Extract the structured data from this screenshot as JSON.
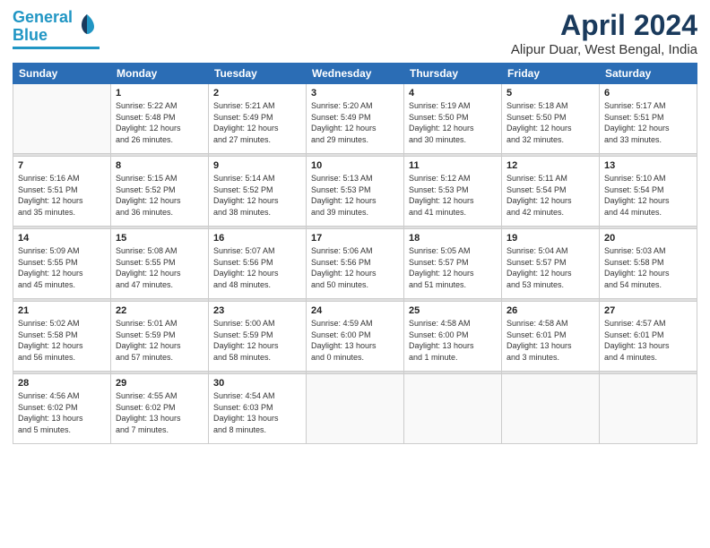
{
  "logo": {
    "line1": "General",
    "line2": "Blue"
  },
  "title": "April 2024",
  "subtitle": "Alipur Duar, West Bengal, India",
  "weekdays": [
    "Sunday",
    "Monday",
    "Tuesday",
    "Wednesday",
    "Thursday",
    "Friday",
    "Saturday"
  ],
  "weeks": [
    [
      {
        "day": "",
        "info": ""
      },
      {
        "day": "1",
        "info": "Sunrise: 5:22 AM\nSunset: 5:48 PM\nDaylight: 12 hours\nand 26 minutes."
      },
      {
        "day": "2",
        "info": "Sunrise: 5:21 AM\nSunset: 5:49 PM\nDaylight: 12 hours\nand 27 minutes."
      },
      {
        "day": "3",
        "info": "Sunrise: 5:20 AM\nSunset: 5:49 PM\nDaylight: 12 hours\nand 29 minutes."
      },
      {
        "day": "4",
        "info": "Sunrise: 5:19 AM\nSunset: 5:50 PM\nDaylight: 12 hours\nand 30 minutes."
      },
      {
        "day": "5",
        "info": "Sunrise: 5:18 AM\nSunset: 5:50 PM\nDaylight: 12 hours\nand 32 minutes."
      },
      {
        "day": "6",
        "info": "Sunrise: 5:17 AM\nSunset: 5:51 PM\nDaylight: 12 hours\nand 33 minutes."
      }
    ],
    [
      {
        "day": "7",
        "info": "Sunrise: 5:16 AM\nSunset: 5:51 PM\nDaylight: 12 hours\nand 35 minutes."
      },
      {
        "day": "8",
        "info": "Sunrise: 5:15 AM\nSunset: 5:52 PM\nDaylight: 12 hours\nand 36 minutes."
      },
      {
        "day": "9",
        "info": "Sunrise: 5:14 AM\nSunset: 5:52 PM\nDaylight: 12 hours\nand 38 minutes."
      },
      {
        "day": "10",
        "info": "Sunrise: 5:13 AM\nSunset: 5:53 PM\nDaylight: 12 hours\nand 39 minutes."
      },
      {
        "day": "11",
        "info": "Sunrise: 5:12 AM\nSunset: 5:53 PM\nDaylight: 12 hours\nand 41 minutes."
      },
      {
        "day": "12",
        "info": "Sunrise: 5:11 AM\nSunset: 5:54 PM\nDaylight: 12 hours\nand 42 minutes."
      },
      {
        "day": "13",
        "info": "Sunrise: 5:10 AM\nSunset: 5:54 PM\nDaylight: 12 hours\nand 44 minutes."
      }
    ],
    [
      {
        "day": "14",
        "info": "Sunrise: 5:09 AM\nSunset: 5:55 PM\nDaylight: 12 hours\nand 45 minutes."
      },
      {
        "day": "15",
        "info": "Sunrise: 5:08 AM\nSunset: 5:55 PM\nDaylight: 12 hours\nand 47 minutes."
      },
      {
        "day": "16",
        "info": "Sunrise: 5:07 AM\nSunset: 5:56 PM\nDaylight: 12 hours\nand 48 minutes."
      },
      {
        "day": "17",
        "info": "Sunrise: 5:06 AM\nSunset: 5:56 PM\nDaylight: 12 hours\nand 50 minutes."
      },
      {
        "day": "18",
        "info": "Sunrise: 5:05 AM\nSunset: 5:57 PM\nDaylight: 12 hours\nand 51 minutes."
      },
      {
        "day": "19",
        "info": "Sunrise: 5:04 AM\nSunset: 5:57 PM\nDaylight: 12 hours\nand 53 minutes."
      },
      {
        "day": "20",
        "info": "Sunrise: 5:03 AM\nSunset: 5:58 PM\nDaylight: 12 hours\nand 54 minutes."
      }
    ],
    [
      {
        "day": "21",
        "info": "Sunrise: 5:02 AM\nSunset: 5:58 PM\nDaylight: 12 hours\nand 56 minutes."
      },
      {
        "day": "22",
        "info": "Sunrise: 5:01 AM\nSunset: 5:59 PM\nDaylight: 12 hours\nand 57 minutes."
      },
      {
        "day": "23",
        "info": "Sunrise: 5:00 AM\nSunset: 5:59 PM\nDaylight: 12 hours\nand 58 minutes."
      },
      {
        "day": "24",
        "info": "Sunrise: 4:59 AM\nSunset: 6:00 PM\nDaylight: 13 hours\nand 0 minutes."
      },
      {
        "day": "25",
        "info": "Sunrise: 4:58 AM\nSunset: 6:00 PM\nDaylight: 13 hours\nand 1 minute."
      },
      {
        "day": "26",
        "info": "Sunrise: 4:58 AM\nSunset: 6:01 PM\nDaylight: 13 hours\nand 3 minutes."
      },
      {
        "day": "27",
        "info": "Sunrise: 4:57 AM\nSunset: 6:01 PM\nDaylight: 13 hours\nand 4 minutes."
      }
    ],
    [
      {
        "day": "28",
        "info": "Sunrise: 4:56 AM\nSunset: 6:02 PM\nDaylight: 13 hours\nand 5 minutes."
      },
      {
        "day": "29",
        "info": "Sunrise: 4:55 AM\nSunset: 6:02 PM\nDaylight: 13 hours\nand 7 minutes."
      },
      {
        "day": "30",
        "info": "Sunrise: 4:54 AM\nSunset: 6:03 PM\nDaylight: 13 hours\nand 8 minutes."
      },
      {
        "day": "",
        "info": ""
      },
      {
        "day": "",
        "info": ""
      },
      {
        "day": "",
        "info": ""
      },
      {
        "day": "",
        "info": ""
      }
    ]
  ]
}
